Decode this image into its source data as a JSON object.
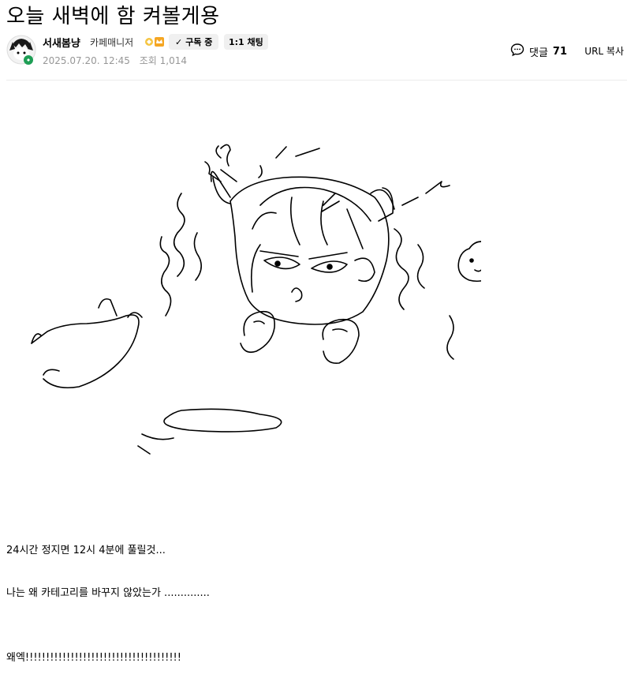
{
  "post": {
    "title": "오늘 새벽에 함 켜볼게용"
  },
  "author": {
    "nickname": "서새봄냥",
    "grade": "카페매니저",
    "subscribe_label": "구독 중",
    "chat_label": "1:1 채팅"
  },
  "meta": {
    "date": "2025.07.20. 12:45",
    "views_label": "조회 1,014"
  },
  "actions": {
    "comment_label": "댓글",
    "comment_count": "71",
    "url_copy_label": "URL 복사"
  },
  "content": {
    "lines": [
      "24시간 정지면 12시 4분에 풀릴것...",
      "나는 왜 카테고리를 바꾸지 않았는가 ..............",
      "왜엑!!!!!!!!!!!!!!!!!!!!!!!!!!!!!!!!!!!!!!"
    ]
  },
  "icons": {
    "check": "check-icon",
    "comment": "comment-bubble-icon",
    "grade_badge": "manager-badge-icon"
  },
  "colors": {
    "meta_text": "#979797",
    "button_bg": "#f0f0f0",
    "divider": "#ebebeb",
    "badge_orange": "#f5a623"
  }
}
